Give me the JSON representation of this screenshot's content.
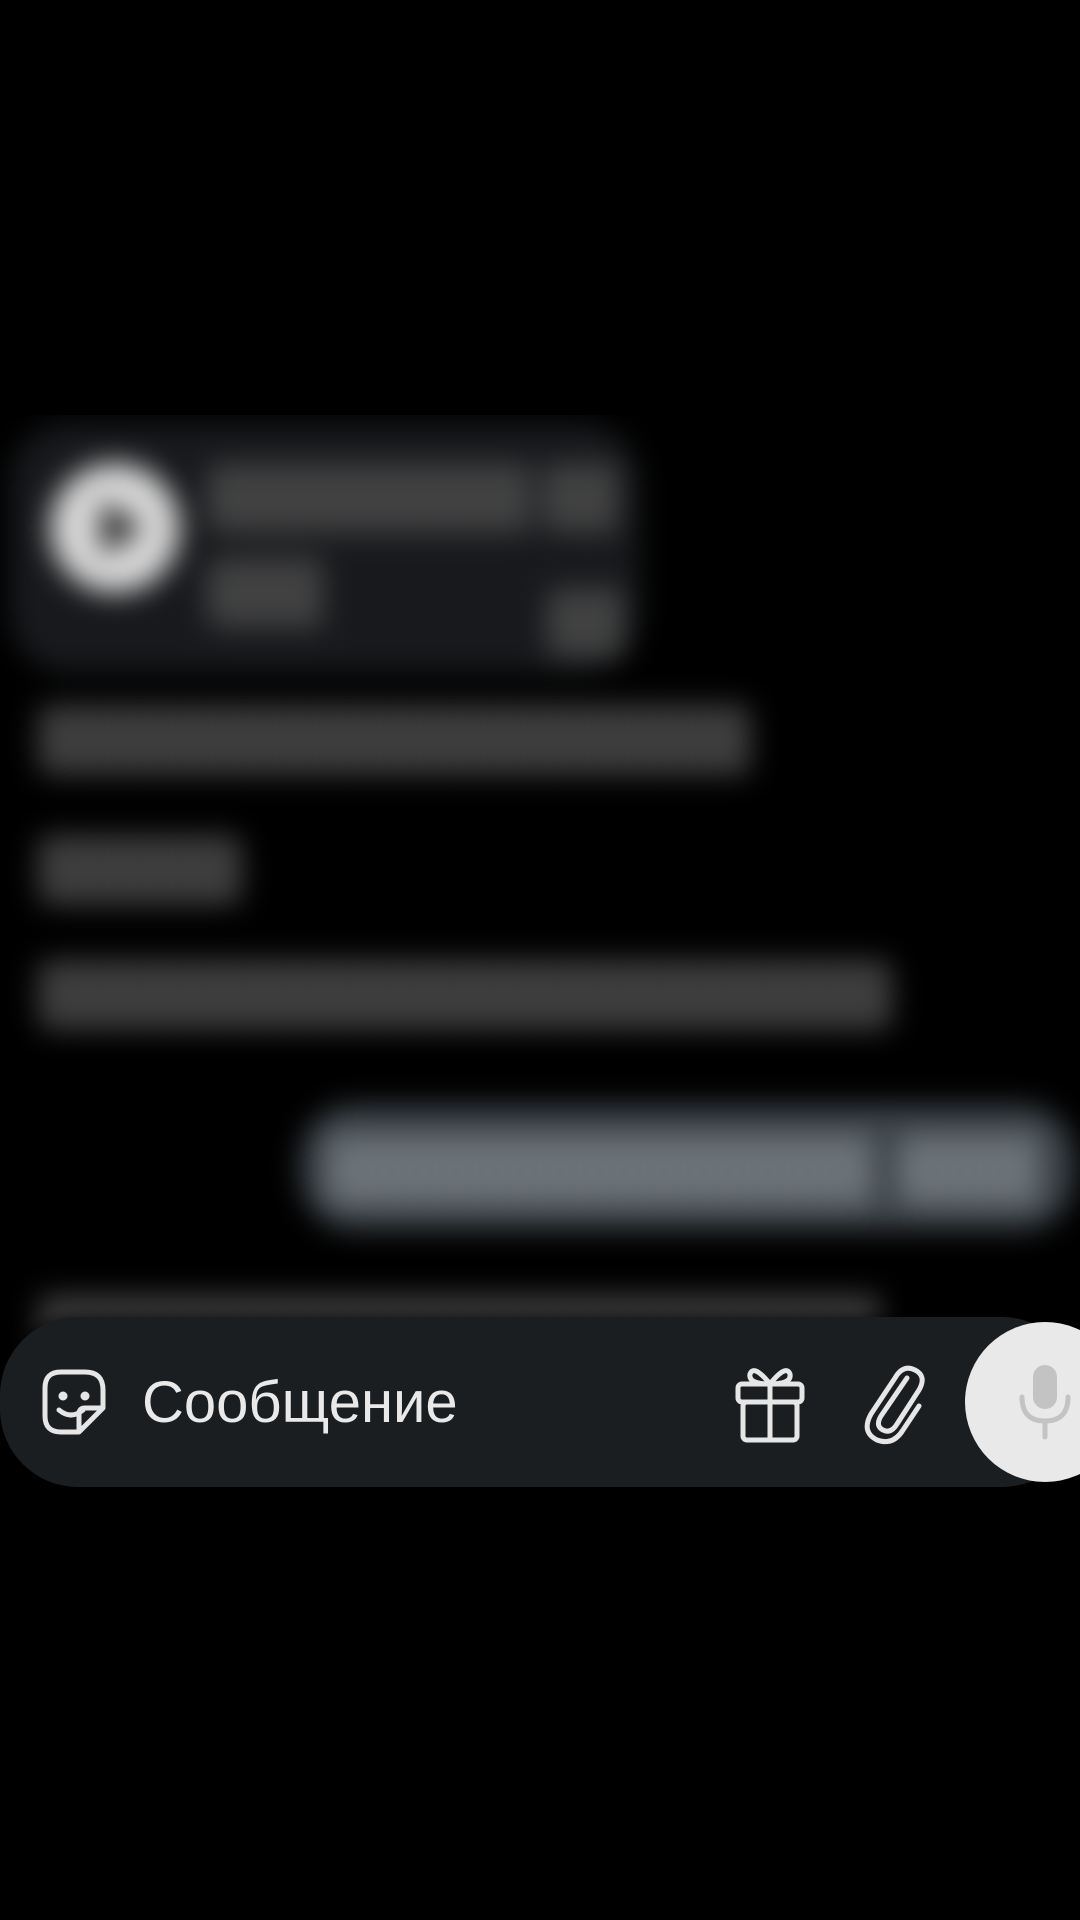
{
  "chat": {
    "messages_note": ""
  },
  "composer": {
    "placeholder": "Сообщение",
    "icons": {
      "sticker": "sticker-icon",
      "gift": "gift-icon",
      "attach": "paperclip-icon",
      "voice": "microphone-icon"
    }
  },
  "colors": {
    "background": "#000000",
    "bar": "#1b1e21",
    "mic_button": "#e9e9e9",
    "icon_stroke": "#e6e6e6"
  }
}
